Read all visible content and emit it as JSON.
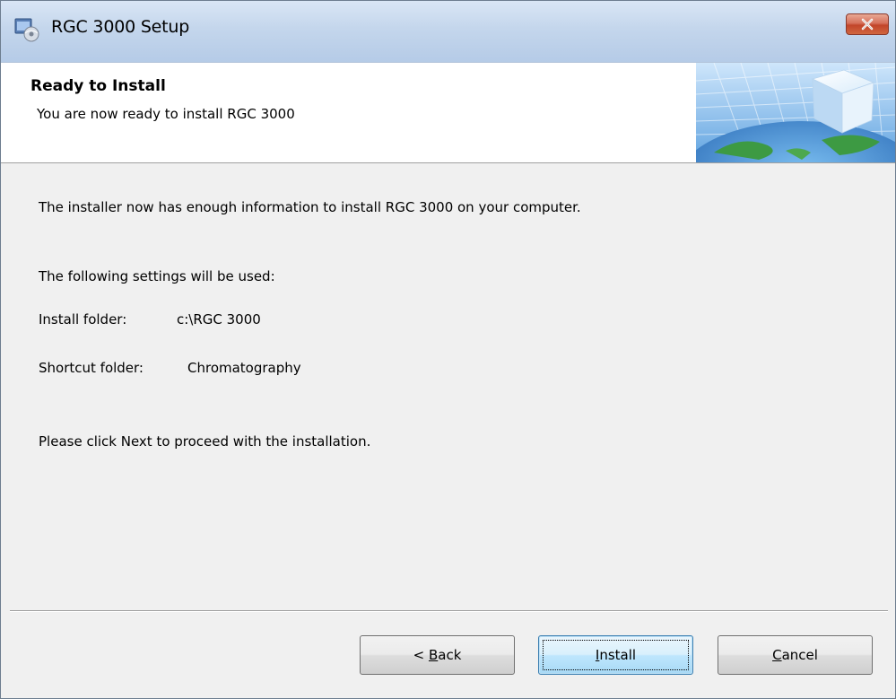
{
  "window": {
    "title": "RGC 3000 Setup",
    "icon": "installer-icon",
    "close_icon": "close-icon"
  },
  "banner": {
    "title": "Ready to Install",
    "subtitle": "You are now ready to install RGC 3000",
    "graphic": "globe-cube-graphic"
  },
  "body": {
    "intro": "The installer now has enough information to install RGC 3000 on your computer.",
    "settings_heading": "The following settings will be used:",
    "settings": [
      {
        "label": "Install folder:",
        "value": "c:\\RGC 3000"
      },
      {
        "label": "Shortcut folder:",
        "value": "Chromatography"
      }
    ],
    "instruction": "Please click Next to proceed with the installation."
  },
  "buttons": {
    "back": {
      "prefix": "< ",
      "mnemonic": "B",
      "rest": "ack"
    },
    "install": {
      "mnemonic": "I",
      "rest": "nstall"
    },
    "cancel": {
      "mnemonic": "C",
      "rest": "ancel"
    }
  },
  "colors": {
    "title_bar": "#c4d6ec",
    "close_button": "#c2452a",
    "dialog_background": "#f0f0f0",
    "banner_background": "#ffffff",
    "default_button_border": "#3c7fb1"
  }
}
